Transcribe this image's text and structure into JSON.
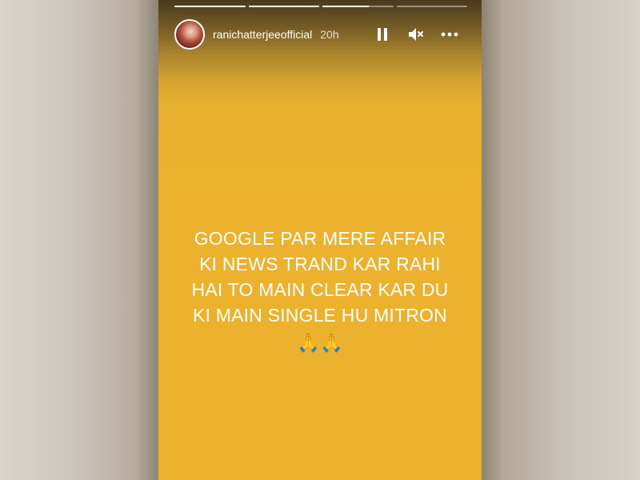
{
  "story": {
    "username": "ranichatterjeeofficial",
    "timestamp": "20h",
    "progress": [
      1,
      1,
      0.65,
      0
    ],
    "text_lines": [
      "GOOGLE PAR MERE AFFAIR",
      "KI NEWS TRAND KAR RAHI",
      "HAI TO MAIN CLEAR KAR DU",
      "KI MAIN SINGLE HU MITRON"
    ],
    "emoji": "🙏🙏",
    "background_color": "#ecb22e",
    "text_color": "#ffffff"
  },
  "controls": {
    "pause_icon": "pause-icon",
    "mute_icon": "speaker-muted-icon",
    "more_icon": "more-horizontal-icon"
  }
}
